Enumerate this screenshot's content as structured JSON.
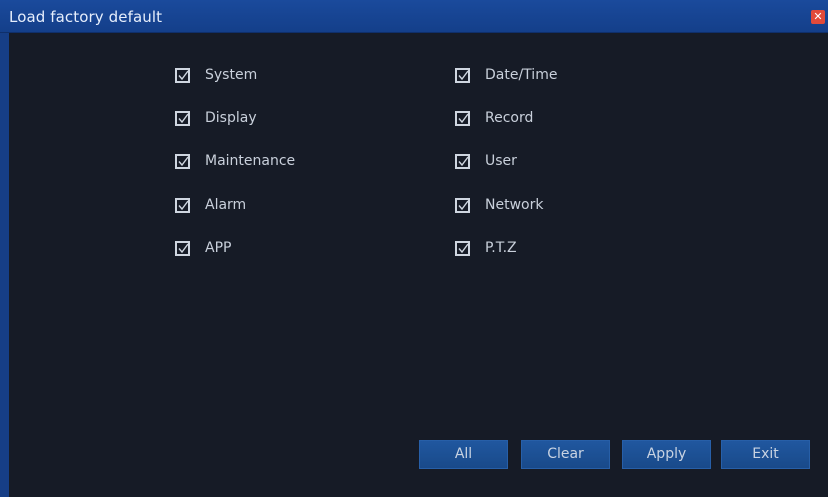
{
  "dialog": {
    "title": "Load factory default",
    "close_icon": "close-icon",
    "close_color": "#e24a3a"
  },
  "left_column": [
    {
      "label": "System",
      "checked": true
    },
    {
      "label": "Display",
      "checked": true
    },
    {
      "label": "Maintenance",
      "checked": true
    },
    {
      "label": "Alarm",
      "checked": true
    },
    {
      "label": "APP",
      "checked": true
    }
  ],
  "right_column": [
    {
      "label": "Date/Time",
      "checked": true
    },
    {
      "label": "Record",
      "checked": true
    },
    {
      "label": "User",
      "checked": true
    },
    {
      "label": "Network",
      "checked": true
    },
    {
      "label": "P.T.Z",
      "checked": true
    }
  ],
  "buttons": {
    "all": "All",
    "clear": "Clear",
    "apply": "Apply",
    "exit": "Exit"
  },
  "colors": {
    "titlebar": "#1a4a9c",
    "background": "#161b26",
    "button": "#20579f",
    "text": "#c9d0db"
  }
}
